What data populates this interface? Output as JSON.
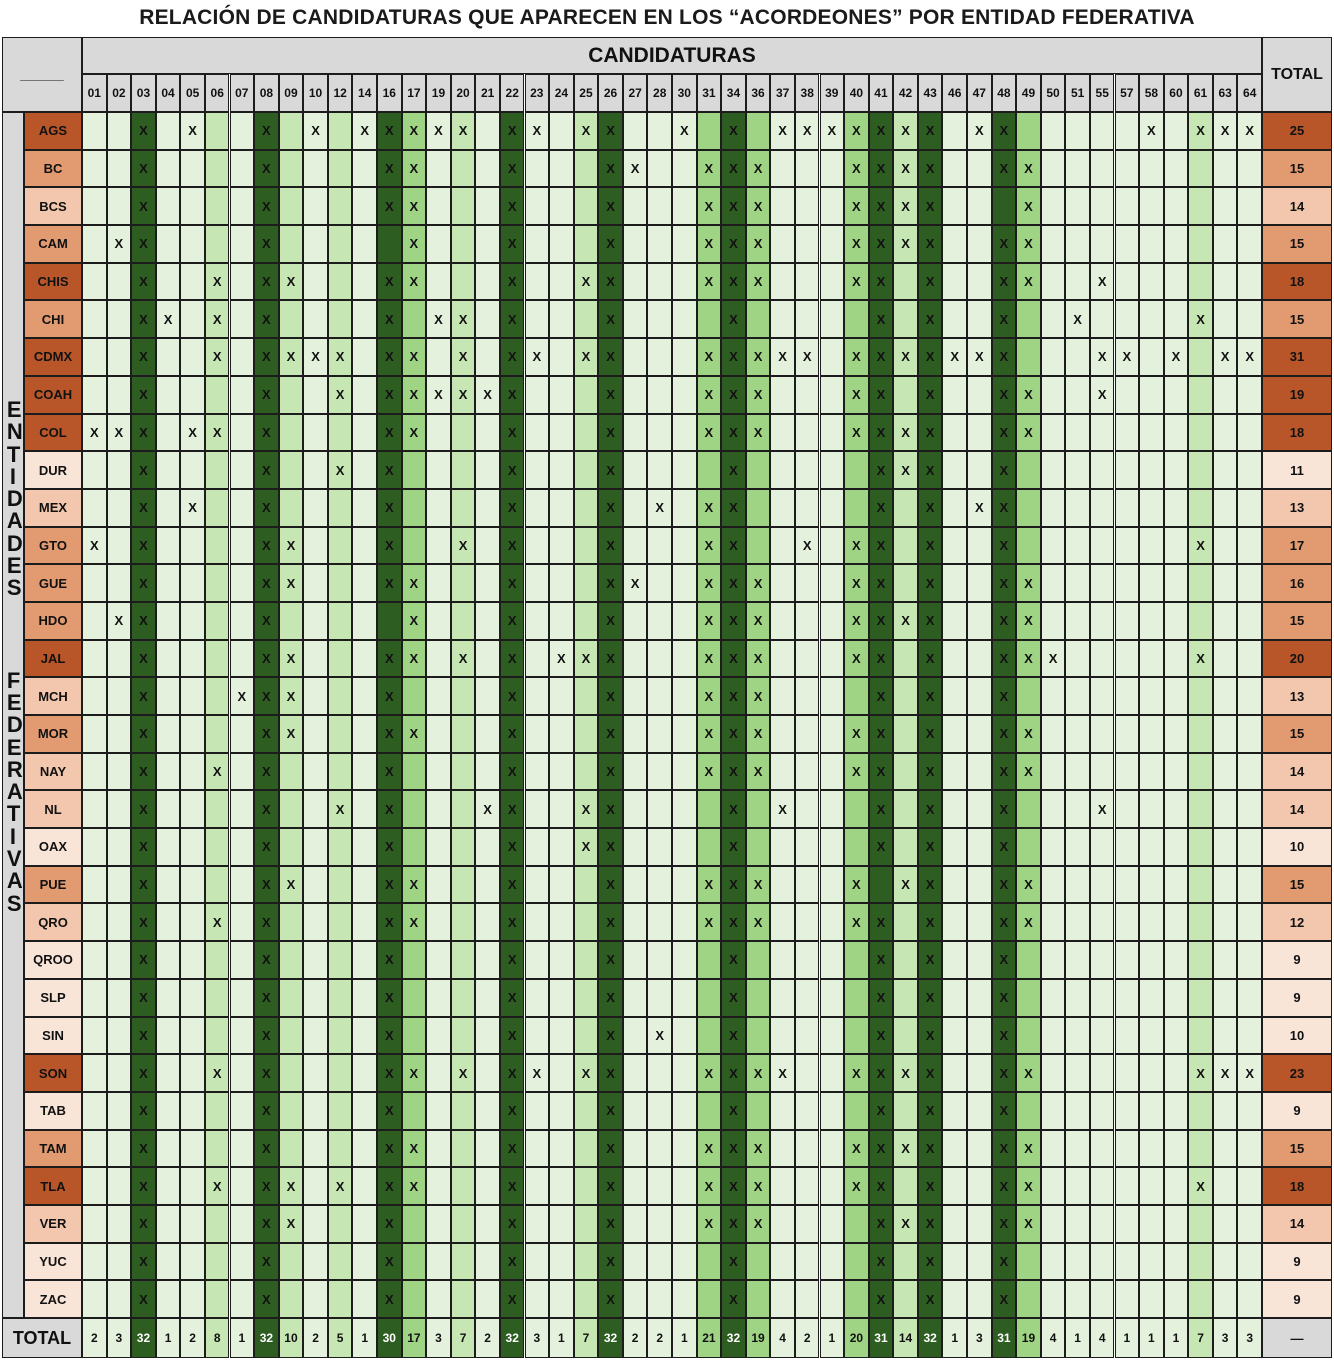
{
  "title": "RELACIÓN DE CANDIDATURAS QUE APARECEN EN LOS “ACORDEONES” POR ENTIDAD FEDERATIVA",
  "header": {
    "corner": "______",
    "candidaturas": "CANDIDATURAS",
    "total": "TOTAL",
    "side_label_top": "ENTIDADES",
    "side_label_bottom": "FEDERATIVAS",
    "footer_label": "TOTAL",
    "footer_total": "—"
  },
  "mark": "X",
  "columns": [
    "01",
    "02",
    "03",
    "04",
    "05",
    "06",
    "07",
    "08",
    "09",
    "10",
    "12",
    "14",
    "16",
    "17",
    "19",
    "20",
    "21",
    "22",
    "23",
    "24",
    "25",
    "26",
    "27",
    "28",
    "30",
    "31",
    "34",
    "36",
    "37",
    "38",
    "39",
    "40",
    "41",
    "42",
    "43",
    "46",
    "47",
    "48",
    "49",
    "50",
    "51",
    "55",
    "57",
    "58",
    "60",
    "61",
    "63",
    "64"
  ],
  "column_totals": [
    "2",
    "3",
    "32",
    "1",
    "2",
    "8",
    "1",
    "32",
    "10",
    "2",
    "5",
    "1",
    "30",
    "17",
    "3",
    "7",
    "2",
    "32",
    "3",
    "1",
    "7",
    "32",
    "2",
    "2",
    "1",
    "21",
    "32",
    "19",
    "4",
    "2",
    "1",
    "20",
    "31",
    "14",
    "32",
    "1",
    "3",
    "31",
    "19",
    "4",
    "1",
    "4",
    "1",
    "1",
    "1",
    "7",
    "3",
    "3"
  ],
  "rows": [
    {
      "name": "AGS",
      "total": "25",
      "marks": [
        "03",
        "05",
        "08",
        "10",
        "14",
        "16",
        "17",
        "19",
        "20",
        "22",
        "23",
        "25",
        "26",
        "30",
        "34",
        "37",
        "38",
        "39",
        "40",
        "41",
        "42",
        "43",
        "47",
        "48",
        "58",
        "61",
        "63",
        "64"
      ]
    },
    {
      "name": "BC",
      "total": "15",
      "marks": [
        "03",
        "08",
        "16",
        "17",
        "22",
        "26",
        "27",
        "31",
        "34",
        "36",
        "40",
        "41",
        "42",
        "43",
        "48",
        "49"
      ]
    },
    {
      "name": "BCS",
      "total": "14",
      "marks": [
        "03",
        "08",
        "16",
        "17",
        "22",
        "26",
        "31",
        "34",
        "36",
        "40",
        "41",
        "42",
        "43",
        "49"
      ]
    },
    {
      "name": "CAM",
      "total": "15",
      "marks": [
        "02",
        "03",
        "08",
        "17",
        "22",
        "26",
        "31",
        "34",
        "36",
        "40",
        "41",
        "42",
        "43",
        "48",
        "49"
      ]
    },
    {
      "name": "CHIS",
      "total": "18",
      "marks": [
        "03",
        "06",
        "08",
        "09",
        "16",
        "17",
        "22",
        "25",
        "26",
        "31",
        "34",
        "36",
        "40",
        "41",
        "43",
        "48",
        "49",
        "55"
      ]
    },
    {
      "name": "CHI",
      "total": "15",
      "marks": [
        "03",
        "04",
        "06",
        "08",
        "16",
        "19",
        "20",
        "22",
        "26",
        "34",
        "41",
        "43",
        "48",
        "51",
        "61"
      ]
    },
    {
      "name": "CDMX",
      "total": "31",
      "marks": [
        "03",
        "06",
        "08",
        "09",
        "10",
        "12",
        "16",
        "17",
        "20",
        "22",
        "23",
        "25",
        "26",
        "31",
        "34",
        "36",
        "37",
        "38",
        "40",
        "41",
        "42",
        "43",
        "46",
        "47",
        "48",
        "55",
        "57",
        "60",
        "63",
        "64"
      ]
    },
    {
      "name": "COAH",
      "total": "19",
      "marks": [
        "03",
        "08",
        "12",
        "16",
        "17",
        "19",
        "20",
        "21",
        "22",
        "26",
        "31",
        "34",
        "36",
        "40",
        "41",
        "43",
        "48",
        "49",
        "55"
      ]
    },
    {
      "name": "COL",
      "total": "18",
      "marks": [
        "01",
        "02",
        "03",
        "05",
        "06",
        "08",
        "16",
        "17",
        "22",
        "26",
        "31",
        "34",
        "36",
        "40",
        "41",
        "42",
        "43",
        "48",
        "49"
      ]
    },
    {
      "name": "DUR",
      "total": "11",
      "marks": [
        "03",
        "08",
        "12",
        "16",
        "22",
        "26",
        "34",
        "41",
        "42",
        "43",
        "48"
      ]
    },
    {
      "name": "MEX",
      "total": "13",
      "marks": [
        "03",
        "05",
        "08",
        "16",
        "22",
        "26",
        "28",
        "31",
        "34",
        "41",
        "43",
        "47",
        "48"
      ]
    },
    {
      "name": "GTO",
      "total": "17",
      "marks": [
        "01",
        "03",
        "08",
        "09",
        "16",
        "20",
        "22",
        "26",
        "31",
        "34",
        "38",
        "40",
        "41",
        "43",
        "48",
        "61"
      ]
    },
    {
      "name": "GUE",
      "total": "16",
      "marks": [
        "03",
        "08",
        "09",
        "16",
        "17",
        "22",
        "26",
        "27",
        "31",
        "34",
        "36",
        "40",
        "41",
        "43",
        "48",
        "49"
      ]
    },
    {
      "name": "HDO",
      "total": "15",
      "marks": [
        "02",
        "03",
        "08",
        "17",
        "22",
        "26",
        "31",
        "34",
        "36",
        "40",
        "41",
        "42",
        "43",
        "48",
        "49"
      ]
    },
    {
      "name": "JAL",
      "total": "20",
      "marks": [
        "03",
        "08",
        "09",
        "16",
        "17",
        "20",
        "22",
        "24",
        "25",
        "26",
        "31",
        "34",
        "36",
        "40",
        "41",
        "43",
        "48",
        "49",
        "50",
        "61"
      ]
    },
    {
      "name": "MCH",
      "total": "13",
      "marks": [
        "03",
        "07",
        "08",
        "09",
        "16",
        "22",
        "26",
        "31",
        "34",
        "36",
        "41",
        "43",
        "48"
      ]
    },
    {
      "name": "MOR",
      "total": "15",
      "marks": [
        "03",
        "08",
        "09",
        "16",
        "17",
        "22",
        "26",
        "31",
        "34",
        "36",
        "40",
        "41",
        "43",
        "48",
        "49"
      ]
    },
    {
      "name": "NAY",
      "total": "14",
      "marks": [
        "03",
        "06",
        "08",
        "16",
        "22",
        "26",
        "31",
        "34",
        "36",
        "40",
        "41",
        "43",
        "48",
        "49"
      ]
    },
    {
      "name": "NL",
      "total": "14",
      "marks": [
        "03",
        "08",
        "12",
        "16",
        "21",
        "22",
        "25",
        "26",
        "34",
        "37",
        "41",
        "43",
        "48",
        "55"
      ]
    },
    {
      "name": "OAX",
      "total": "10",
      "marks": [
        "03",
        "08",
        "16",
        "22",
        "25",
        "26",
        "34",
        "41",
        "43",
        "48"
      ]
    },
    {
      "name": "PUE",
      "total": "15",
      "marks": [
        "03",
        "08",
        "09",
        "16",
        "17",
        "22",
        "26",
        "31",
        "34",
        "36",
        "40",
        "42",
        "43",
        "48",
        "49"
      ]
    },
    {
      "name": "QRO",
      "total": "12",
      "marks": [
        "03",
        "06",
        "08",
        "16",
        "17",
        "22",
        "26",
        "31",
        "34",
        "36",
        "40",
        "41",
        "43",
        "48",
        "49"
      ]
    },
    {
      "name": "QROO",
      "total": "9",
      "marks": [
        "03",
        "08",
        "16",
        "22",
        "26",
        "34",
        "41",
        "43",
        "48"
      ]
    },
    {
      "name": "SLP",
      "total": "9",
      "marks": [
        "03",
        "08",
        "16",
        "22",
        "26",
        "34",
        "41",
        "43",
        "48"
      ]
    },
    {
      "name": "SIN",
      "total": "10",
      "marks": [
        "03",
        "08",
        "16",
        "22",
        "26",
        "28",
        "34",
        "41",
        "43",
        "48"
      ]
    },
    {
      "name": "SON",
      "total": "23",
      "marks": [
        "03",
        "06",
        "08",
        "16",
        "17",
        "20",
        "22",
        "23",
        "25",
        "26",
        "31",
        "34",
        "36",
        "37",
        "40",
        "41",
        "42",
        "43",
        "48",
        "49",
        "61",
        "63",
        "64"
      ]
    },
    {
      "name": "TAB",
      "total": "9",
      "marks": [
        "03",
        "08",
        "16",
        "22",
        "26",
        "34",
        "41",
        "43",
        "48"
      ]
    },
    {
      "name": "TAM",
      "total": "15",
      "marks": [
        "03",
        "08",
        "16",
        "17",
        "22",
        "26",
        "31",
        "34",
        "36",
        "40",
        "41",
        "42",
        "43",
        "48",
        "49"
      ]
    },
    {
      "name": "TLA",
      "total": "18",
      "marks": [
        "03",
        "06",
        "08",
        "09",
        "12",
        "16",
        "17",
        "22",
        "26",
        "31",
        "34",
        "36",
        "40",
        "41",
        "43",
        "48",
        "49",
        "61"
      ]
    },
    {
      "name": "VER",
      "total": "14",
      "marks": [
        "03",
        "08",
        "09",
        "16",
        "22",
        "26",
        "31",
        "34",
        "36",
        "41",
        "42",
        "43",
        "48",
        "49"
      ]
    },
    {
      "name": "YUC",
      "total": "9",
      "marks": [
        "03",
        "08",
        "16",
        "22",
        "26",
        "34",
        "41",
        "43",
        "48"
      ]
    },
    {
      "name": "ZAC",
      "total": "9",
      "marks": [
        "03",
        "08",
        "16",
        "22",
        "26",
        "34",
        "41",
        "43",
        "48"
      ]
    }
  ],
  "colors": {
    "header_gray": "#d9d9d9",
    "col_pale": "#e4f2dd",
    "col_mid": "#c6e6b4",
    "col_strong": "#a0d485",
    "col_dark": "#2e5d22",
    "row_tier1": "#f9e4d8",
    "row_tier2": "#f2c7ad",
    "row_tier3": "#e29a71",
    "row_tier4": "#b8562a"
  }
}
